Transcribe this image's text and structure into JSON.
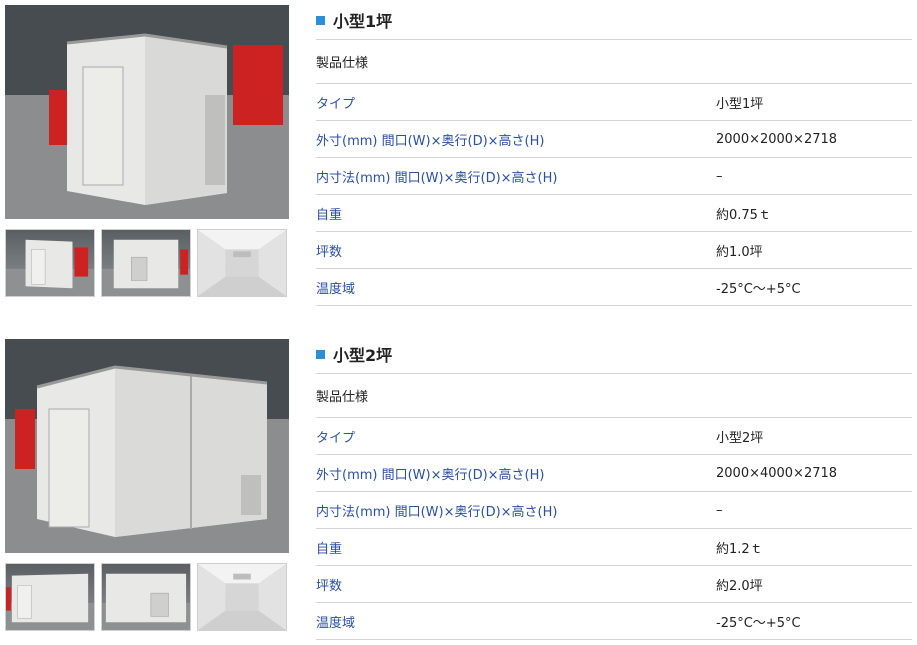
{
  "products": [
    {
      "title": "小型1坪",
      "section_label": "製品仕様",
      "rows": [
        {
          "label": "タイプ",
          "value": "小型1坪"
        },
        {
          "label": "外寸(mm) 間口(W)×奥行(D)×高さ(H)",
          "value": "2000×2000×2718"
        },
        {
          "label": "内寸法(mm) 間口(W)×奥行(D)×高さ(H)",
          "value": "–"
        },
        {
          "label": "自重",
          "value": "約0.75ｔ"
        },
        {
          "label": "坪数",
          "value": "約1.0坪"
        },
        {
          "label": "温度域",
          "value": "-25°C～+5°C"
        }
      ]
    },
    {
      "title": "小型2坪",
      "section_label": "製品仕様",
      "rows": [
        {
          "label": "タイプ",
          "value": "小型2坪"
        },
        {
          "label": "外寸(mm) 間口(W)×奥行(D)×高さ(H)",
          "value": "2000×4000×2718"
        },
        {
          "label": "内寸法(mm) 間口(W)×奥行(D)×高さ(H)",
          "value": "–"
        },
        {
          "label": "自重",
          "value": "約1.2ｔ"
        },
        {
          "label": "坪数",
          "value": "約2.0坪"
        },
        {
          "label": "温度域",
          "value": "-25°C～+5°C"
        }
      ]
    }
  ],
  "colors": {
    "accent": "#2b8fd8",
    "label": "#2a4fa3",
    "rule": "#d3d3d3"
  },
  "icons": {
    "title_marker": "square-bullet"
  }
}
